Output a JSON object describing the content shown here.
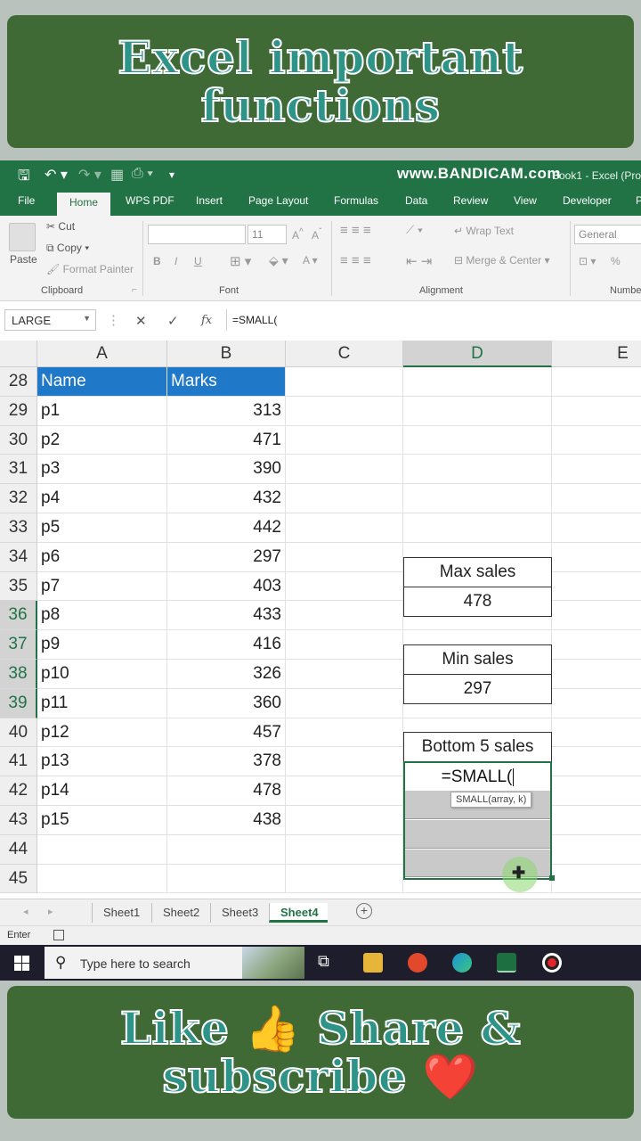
{
  "banner_top": {
    "line1": "Excel important",
    "line2": "functions"
  },
  "banner_bottom": {
    "line1": "Like 👍 Share &",
    "line2": "subscribe ❤️"
  },
  "titlebar": {
    "watermark": "www.BANDICAM.com",
    "title": "Book1 - Excel (Pro"
  },
  "ribbon_tabs": [
    "File",
    "Home",
    "WPS PDF",
    "Insert",
    "Page Layout",
    "Formulas",
    "Data",
    "Review",
    "View",
    "Developer",
    "P"
  ],
  "active_tab": "Home",
  "clipboard": {
    "paste": "Paste",
    "cut": "Cut",
    "copy": "Copy",
    "format_painter": "Format Painter",
    "label": "Clipboard"
  },
  "font_group": {
    "font_size": "11",
    "label": "Font",
    "bold": "B",
    "italic": "I",
    "underline": "U",
    "grow": "A",
    "shrink": "A",
    "color": "A"
  },
  "alignment_group": {
    "wrap_text": "Wrap Text",
    "merge_center": "Merge & Center",
    "label": "Alignment"
  },
  "number_group": {
    "format": "General",
    "percent": "%",
    "label": "Numbe"
  },
  "formula_bar": {
    "name_box": "LARGE",
    "cancel": "✕",
    "enter": "✓",
    "fx": "fx",
    "formula": "=SMALL("
  },
  "columns": [
    "A",
    "B",
    "C",
    "D",
    "E"
  ],
  "rows": [
    "28",
    "29",
    "30",
    "31",
    "32",
    "33",
    "34",
    "35",
    "36",
    "37",
    "38",
    "39",
    "40",
    "41",
    "42",
    "43",
    "44",
    "45"
  ],
  "table": {
    "headers": [
      "Name",
      "Marks"
    ],
    "data": [
      [
        "p1",
        "313"
      ],
      [
        "p2",
        "471"
      ],
      [
        "p3",
        "390"
      ],
      [
        "p4",
        "432"
      ],
      [
        "p5",
        "442"
      ],
      [
        "p6",
        "297"
      ],
      [
        "p7",
        "403"
      ],
      [
        "p8",
        "433"
      ],
      [
        "p9",
        "416"
      ],
      [
        "p10",
        "326"
      ],
      [
        "p11",
        "360"
      ],
      [
        "p12",
        "457"
      ],
      [
        "p13",
        "378"
      ],
      [
        "p14",
        "478"
      ],
      [
        "p15",
        "438"
      ]
    ]
  },
  "summary": {
    "max_label": "Max sales",
    "max_value": "478",
    "min_label": "Min sales",
    "min_value": "297",
    "bottom_label": "Bottom 5 sales",
    "editing": "=SMALL(",
    "tooltip": "SMALL(array, k)"
  },
  "sheets": [
    "Sheet1",
    "Sheet2",
    "Sheet3",
    "Sheet4"
  ],
  "active_sheet": "Sheet4",
  "add_sheet": "+",
  "status": {
    "mode": "Enter"
  },
  "taskbar": {
    "search_placeholder": "Type here to search"
  },
  "colors": {
    "excel_green": "#217346",
    "header_blue": "#1f78c8",
    "banner_green": "#3f6a35",
    "banner_text": "#2e9488"
  }
}
